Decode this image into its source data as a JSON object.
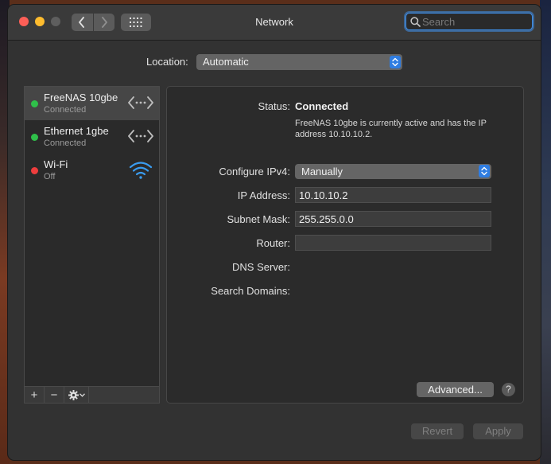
{
  "window": {
    "title": "Network"
  },
  "search": {
    "placeholder": "Search"
  },
  "location": {
    "label": "Location:",
    "value": "Automatic"
  },
  "services": [
    {
      "name": "FreeNAS 10gbe",
      "status": "Connected",
      "status_color": "#2fc04a",
      "icon": "ethernet-arrows-icon",
      "selected": true
    },
    {
      "name": "Ethernet 1gbe",
      "status": "Connected",
      "status_color": "#2fc04a",
      "icon": "ethernet-arrows-icon",
      "selected": false
    },
    {
      "name": "Wi-Fi",
      "status": "Off",
      "status_color": "#ee3d3d",
      "icon": "wifi-icon",
      "selected": false
    }
  ],
  "sidebar_toolbar": {
    "add": "+",
    "remove": "−"
  },
  "detail": {
    "status_label": "Status:",
    "status_value": "Connected",
    "status_description": "FreeNAS 10gbe is currently active and has the IP address 10.10.10.2.",
    "configure_label": "Configure IPv4:",
    "configure_value": "Manually",
    "ip_label": "IP Address:",
    "ip_value": "10.10.10.2",
    "subnet_label": "Subnet Mask:",
    "subnet_value": "255.255.0.0",
    "router_label": "Router:",
    "router_value": "",
    "dns_label": "DNS Server:",
    "search_domains_label": "Search Domains:",
    "advanced_label": "Advanced...",
    "help_label": "?"
  },
  "footer": {
    "revert_label": "Revert",
    "apply_label": "Apply"
  },
  "colors": {
    "accent": "#2f7de2",
    "connected": "#2fc04a",
    "off": "#ee3d3d",
    "wifi": "#3a9cf0"
  }
}
